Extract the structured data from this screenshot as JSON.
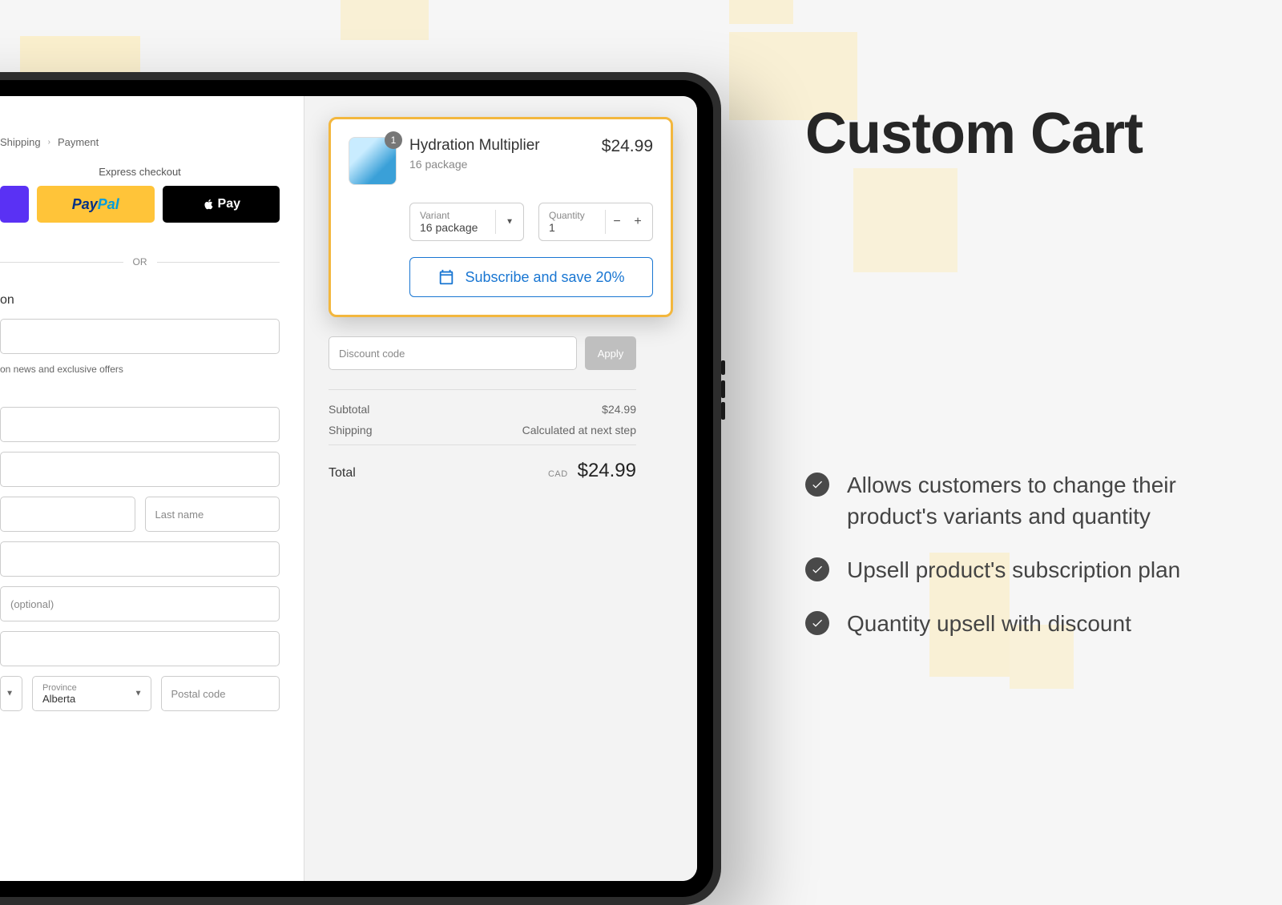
{
  "page_title": "Custom Cart",
  "features": [
    "Allows customers to change their product's variants and quantity",
    "Upsell product's subscription plan",
    "Quantity upsell with discount"
  ],
  "breadcrumb": {
    "shipping": "Shipping",
    "payment": "Payment"
  },
  "express": {
    "title": "Express checkout",
    "paypal_p": "Pay",
    "paypal_pal": "Pal",
    "apple": "Pay",
    "or": "OR"
  },
  "contact_section": "on",
  "offers_text": "on news and exclusive offers",
  "fields": {
    "last_name": "Last name",
    "optional": "(optional)",
    "province_label": "Province",
    "province_value": "Alberta",
    "postal": "Postal code"
  },
  "cart": {
    "badge": "1",
    "name": "Hydration Multiplier",
    "subtitle": "16 package",
    "price": "$24.99",
    "variant_label": "Variant",
    "variant_value": "16 package",
    "qty_label": "Quantity",
    "qty_value": "1",
    "subscribe": "Subscribe and save 20%"
  },
  "discount": {
    "placeholder": "Discount code",
    "apply": "Apply"
  },
  "totals": {
    "subtotal_label": "Subtotal",
    "subtotal_value": "$24.99",
    "shipping_label": "Shipping",
    "shipping_value": "Calculated at next step",
    "total_label": "Total",
    "total_currency": "CAD",
    "total_value": "$24.99"
  }
}
